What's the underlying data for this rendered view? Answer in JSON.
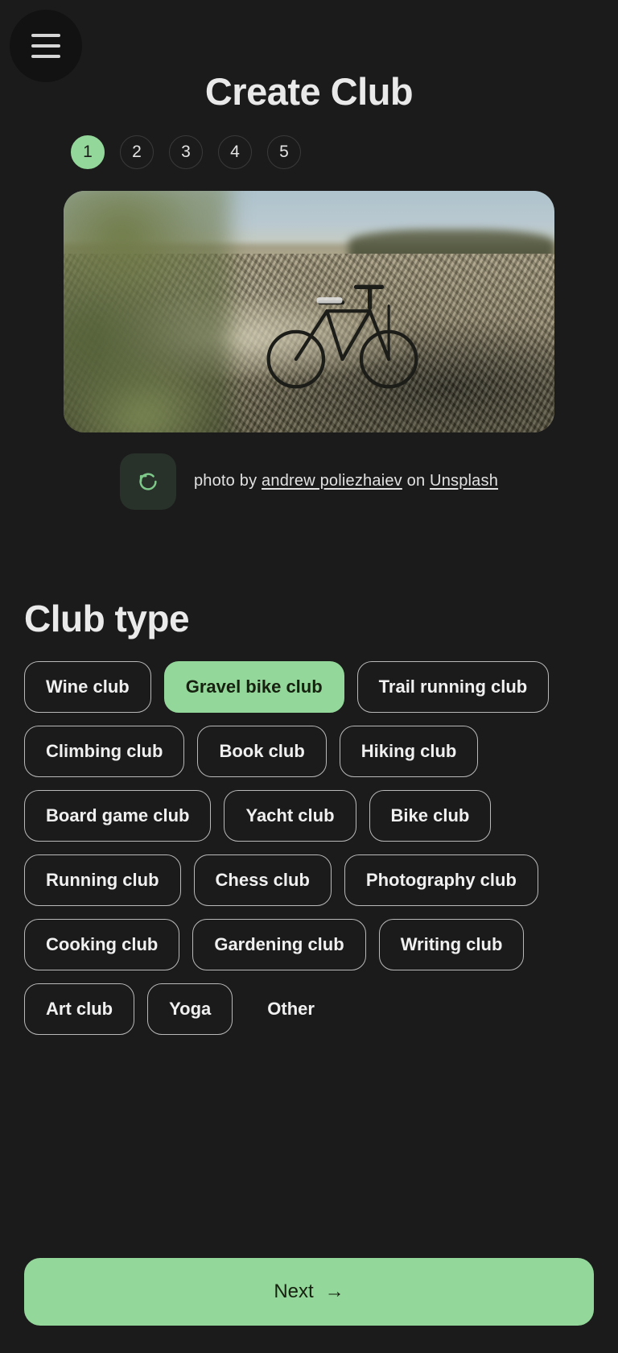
{
  "header": {
    "menu_icon": "hamburger-menu-icon",
    "title": "Create Club"
  },
  "steps": {
    "items": [
      "1",
      "2",
      "3",
      "4",
      "5"
    ],
    "active_index": 0,
    "active_color": "#93d79a"
  },
  "hero": {
    "alt": "gravel bike standing on a dirt trail in a field",
    "refresh_icon": "refresh-counterclockwise-icon",
    "credit_prefix": "photo by ",
    "credit_author": "andrew poliezhaiev",
    "credit_middle": " on ",
    "credit_source": "Unsplash"
  },
  "club_type": {
    "heading": "Club type",
    "selected": "Gravel bike club",
    "options": [
      {
        "label": "Wine club",
        "selected": false,
        "bordered": true
      },
      {
        "label": "Gravel bike club",
        "selected": true,
        "bordered": true
      },
      {
        "label": "Trail running club",
        "selected": false,
        "bordered": true
      },
      {
        "label": "Climbing club",
        "selected": false,
        "bordered": true
      },
      {
        "label": "Book club",
        "selected": false,
        "bordered": true
      },
      {
        "label": "Hiking club",
        "selected": false,
        "bordered": true
      },
      {
        "label": "Board game club",
        "selected": false,
        "bordered": true
      },
      {
        "label": "Yacht club",
        "selected": false,
        "bordered": true
      },
      {
        "label": "Bike club",
        "selected": false,
        "bordered": true
      },
      {
        "label": "Running club",
        "selected": false,
        "bordered": true
      },
      {
        "label": "Chess club",
        "selected": false,
        "bordered": true
      },
      {
        "label": "Photography club",
        "selected": false,
        "bordered": true
      },
      {
        "label": "Cooking club",
        "selected": false,
        "bordered": true
      },
      {
        "label": "Gardening club",
        "selected": false,
        "bordered": true
      },
      {
        "label": "Writing club",
        "selected": false,
        "bordered": true
      },
      {
        "label": "Art club",
        "selected": false,
        "bordered": true
      },
      {
        "label": "Yoga",
        "selected": false,
        "bordered": true
      },
      {
        "label": "Other",
        "selected": false,
        "bordered": false
      }
    ]
  },
  "footer": {
    "next_label": "Next",
    "next_arrow": "→",
    "next_color": "#93d79a"
  },
  "theme": {
    "background": "#1b1b1b",
    "text": "#eaeaea",
    "accent": "#93d79a",
    "chip_border": "#b9b9b9"
  }
}
